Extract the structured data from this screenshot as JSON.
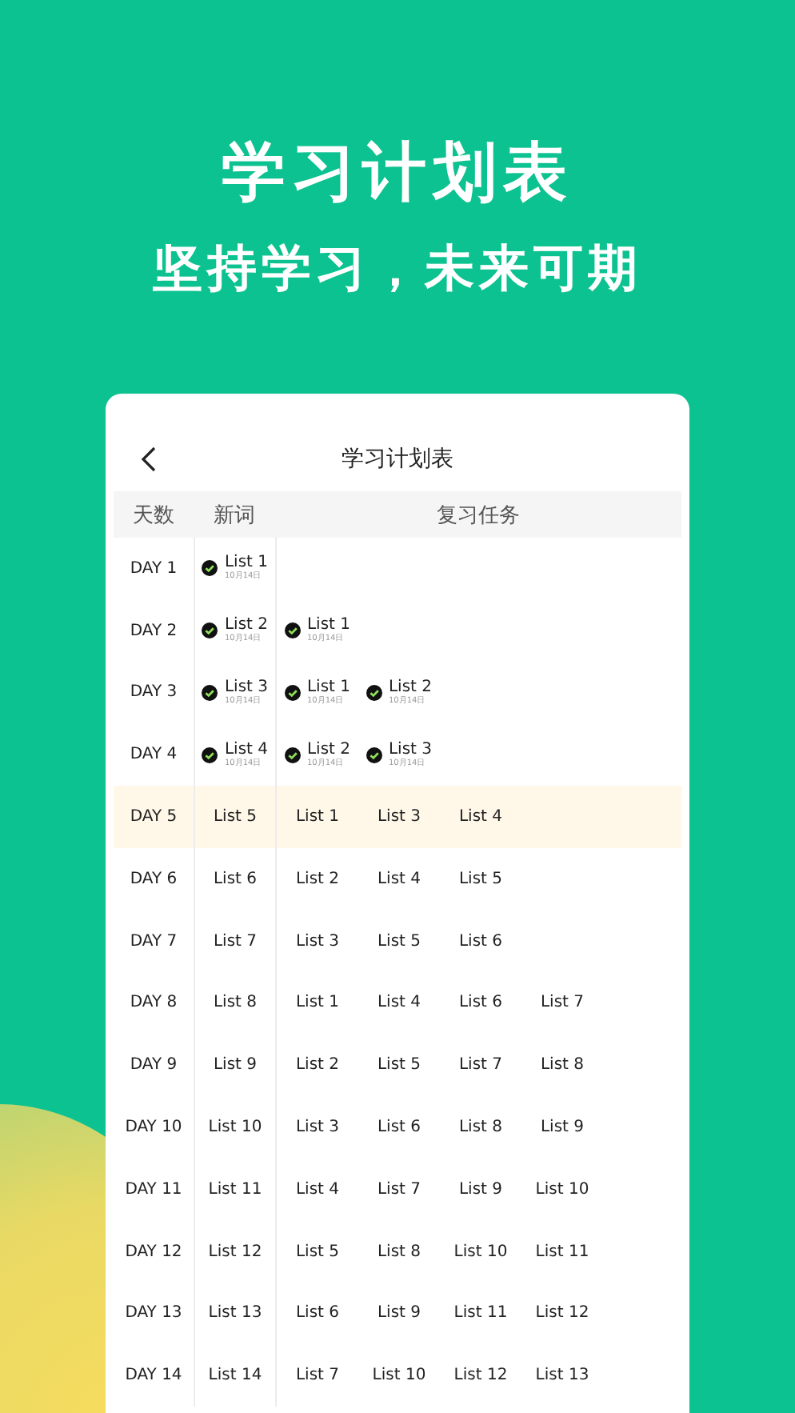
{
  "headline": "学习计划表",
  "subheadline": "坚持学习，未来可期",
  "card": {
    "title": "学习计划表",
    "columns": [
      "天数",
      "新词",
      "复习任务"
    ],
    "rows": [
      {
        "day": "DAY 1",
        "selected": false,
        "new": {
          "label": "List 1",
          "checked": true,
          "date": "10月14日"
        },
        "reviews": []
      },
      {
        "day": "DAY 2",
        "selected": false,
        "new": {
          "label": "List 2",
          "checked": true,
          "date": "10月14日"
        },
        "reviews": [
          {
            "label": "List 1",
            "checked": true,
            "date": "10月14日"
          }
        ]
      },
      {
        "day": "DAY 3",
        "selected": false,
        "new": {
          "label": "List 3",
          "checked": true,
          "date": "10月14日"
        },
        "reviews": [
          {
            "label": "List 1",
            "checked": true,
            "date": "10月14日"
          },
          {
            "label": "List 2",
            "checked": true,
            "date": "10月14日"
          }
        ]
      },
      {
        "day": "DAY 4",
        "selected": false,
        "new": {
          "label": "List 4",
          "checked": true,
          "date": "10月14日"
        },
        "reviews": [
          {
            "label": "List 2",
            "checked": true,
            "date": "10月14日"
          },
          {
            "label": "List 3",
            "checked": true,
            "date": "10月14日"
          }
        ]
      },
      {
        "day": "DAY 5",
        "selected": true,
        "new": {
          "label": "List 5",
          "checked": false
        },
        "reviews": [
          {
            "label": "List 1",
            "checked": false
          },
          {
            "label": "List 3",
            "checked": false
          },
          {
            "label": "List 4",
            "checked": false
          }
        ]
      },
      {
        "day": "DAY 6",
        "selected": false,
        "new": {
          "label": "List 6",
          "checked": false
        },
        "reviews": [
          {
            "label": "List 2",
            "checked": false
          },
          {
            "label": "List 4",
            "checked": false
          },
          {
            "label": "List 5",
            "checked": false
          }
        ]
      },
      {
        "day": "DAY 7",
        "selected": false,
        "new": {
          "label": "List 7",
          "checked": false
        },
        "reviews": [
          {
            "label": "List 3",
            "checked": false
          },
          {
            "label": "List 5",
            "checked": false
          },
          {
            "label": "List 6",
            "checked": false
          }
        ]
      },
      {
        "day": "DAY 8",
        "selected": false,
        "new": {
          "label": "List 8",
          "checked": false
        },
        "reviews": [
          {
            "label": "List 1",
            "checked": false
          },
          {
            "label": "List 4",
            "checked": false
          },
          {
            "label": "List 6",
            "checked": false
          },
          {
            "label": "List 7",
            "checked": false
          }
        ]
      },
      {
        "day": "DAY 9",
        "selected": false,
        "new": {
          "label": "List 9",
          "checked": false
        },
        "reviews": [
          {
            "label": "List 2",
            "checked": false
          },
          {
            "label": "List 5",
            "checked": false
          },
          {
            "label": "List 7",
            "checked": false
          },
          {
            "label": "List 8",
            "checked": false
          }
        ]
      },
      {
        "day": "DAY 10",
        "selected": false,
        "new": {
          "label": "List 10",
          "checked": false
        },
        "reviews": [
          {
            "label": "List 3",
            "checked": false
          },
          {
            "label": "List 6",
            "checked": false
          },
          {
            "label": "List 8",
            "checked": false
          },
          {
            "label": "List 9",
            "checked": false
          }
        ]
      },
      {
        "day": "DAY 11",
        "selected": false,
        "new": {
          "label": "List 11",
          "checked": false
        },
        "reviews": [
          {
            "label": "List 4",
            "checked": false
          },
          {
            "label": "List 7",
            "checked": false
          },
          {
            "label": "List 9",
            "checked": false
          },
          {
            "label": "List 10",
            "checked": false
          }
        ]
      },
      {
        "day": "DAY 12",
        "selected": false,
        "new": {
          "label": "List 12",
          "checked": false
        },
        "reviews": [
          {
            "label": "List 5",
            "checked": false
          },
          {
            "label": "List 8",
            "checked": false
          },
          {
            "label": "List 10",
            "checked": false
          },
          {
            "label": "List 11",
            "checked": false
          }
        ]
      },
      {
        "day": "DAY 13",
        "selected": false,
        "new": {
          "label": "List 13",
          "checked": false
        },
        "reviews": [
          {
            "label": "List 6",
            "checked": false
          },
          {
            "label": "List 9",
            "checked": false
          },
          {
            "label": "List 11",
            "checked": false
          },
          {
            "label": "List 12",
            "checked": false
          }
        ]
      },
      {
        "day": "DAY 14",
        "selected": false,
        "new": {
          "label": "List 14",
          "checked": false
        },
        "reviews": [
          {
            "label": "List 7",
            "checked": false
          },
          {
            "label": "List 10",
            "checked": false
          },
          {
            "label": "List 12",
            "checked": false
          },
          {
            "label": "List 13",
            "checked": false
          }
        ]
      }
    ]
  }
}
